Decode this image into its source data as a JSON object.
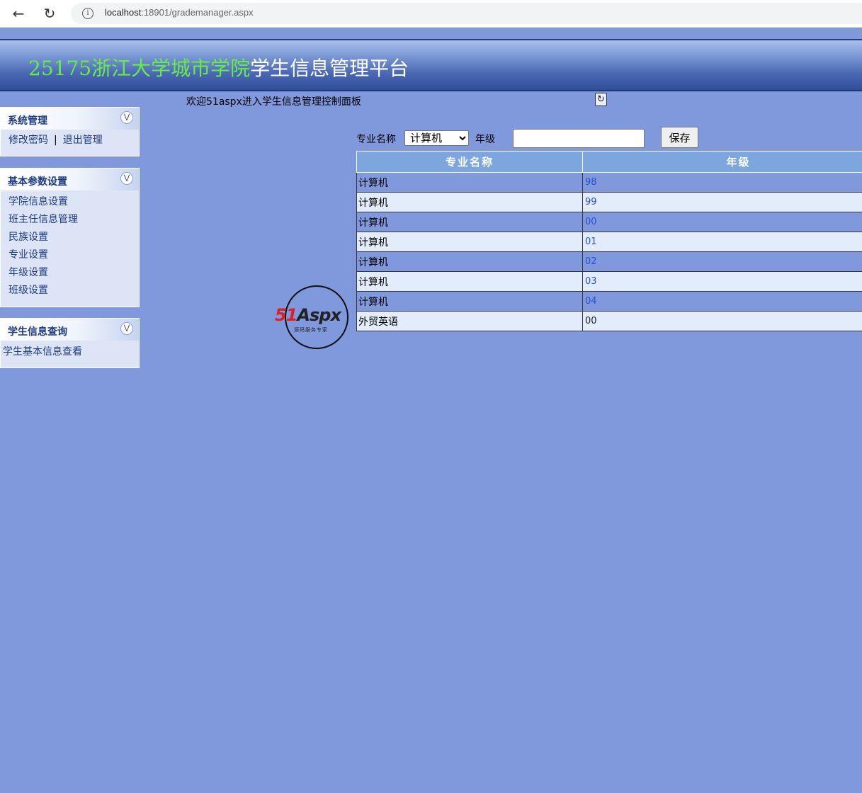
{
  "browser": {
    "url_host": "localhost",
    "url_rest": ":18901/grademanager.aspx"
  },
  "header": {
    "title_green": "25175浙江大学城市学院",
    "title_white": "学生信息管理平台"
  },
  "welcome": "欢迎51aspx进入学生信息管理控制面板",
  "sidebar": {
    "system": {
      "title": "系统管理",
      "change_password": "修改密码",
      "separator": "|",
      "logout": "退出管理"
    },
    "params": {
      "title": "基本参数设置",
      "items": [
        {
          "label": "学院信息设置"
        },
        {
          "label": "班主任信息管理"
        },
        {
          "label": "民族设置"
        },
        {
          "label": "专业设置"
        },
        {
          "label": "年级设置"
        },
        {
          "label": "班级设置"
        }
      ]
    },
    "query": {
      "title": "学生信息查询",
      "items": [
        {
          "label": "学生基本信息查看"
        }
      ]
    }
  },
  "logo": {
    "text_red": "51",
    "text_dark": "Aspx",
    "subtitle": "源码服务专家"
  },
  "form": {
    "major_label": "专业名称",
    "major_selected": "计算机",
    "grade_label": "年级",
    "grade_value": "",
    "save_label": "保存"
  },
  "table": {
    "headers": [
      "专业名称",
      "年级"
    ],
    "rows": [
      {
        "major": "计算机",
        "grade": "98"
      },
      {
        "major": "计算机",
        "grade": "99"
      },
      {
        "major": "计算机",
        "grade": "00"
      },
      {
        "major": "计算机",
        "grade": "01"
      },
      {
        "major": "计算机",
        "grade": "02"
      },
      {
        "major": "计算机",
        "grade": "03"
      },
      {
        "major": "计算机",
        "grade": "04"
      },
      {
        "major": "外贸英语",
        "grade": "00"
      }
    ]
  }
}
